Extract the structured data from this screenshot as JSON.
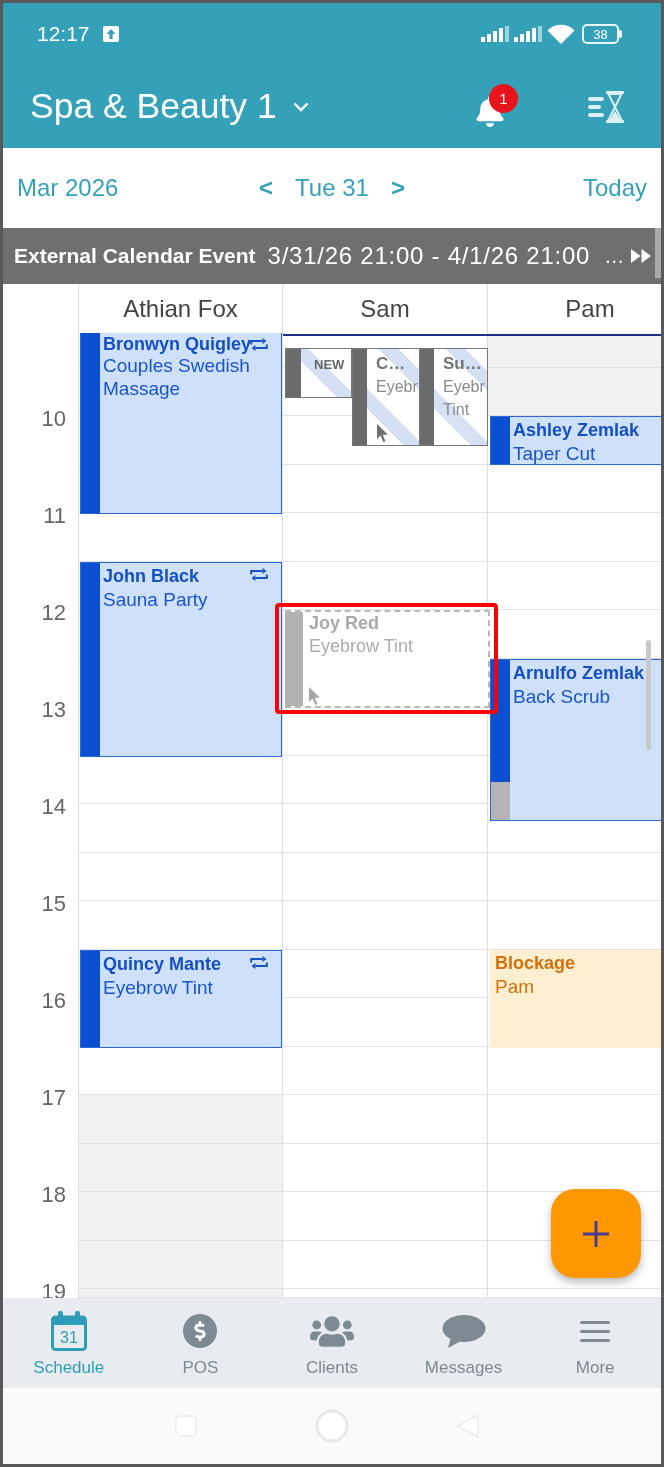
{
  "status_bar": {
    "time": "12:17",
    "battery": "38"
  },
  "app_bar": {
    "title": "Spa & Beauty 1",
    "notification_count": "1"
  },
  "date_nav": {
    "month": "Mar 2026",
    "prev": "<",
    "day": "Tue 31",
    "next": ">",
    "today": "Today"
  },
  "external_event": {
    "title": "External Calendar Event",
    "range": "3/31/26 21:00 - 4/1/26 21:00",
    "overflow": "…"
  },
  "hours": [
    "10",
    "11",
    "12",
    "13",
    "14",
    "15",
    "16",
    "17",
    "18",
    "19"
  ],
  "columns": [
    {
      "name": "Athian Fox",
      "events": [
        {
          "kind": "appointment",
          "client": "Bronwyn Quigley",
          "service": "Couples Swedish Massage",
          "recurring": true,
          "buffer_time": false
        },
        {
          "kind": "appointment",
          "client": "John Black",
          "service": "Sauna Party",
          "recurring": true,
          "buffer_time": false
        },
        {
          "kind": "appointment",
          "client": "Quincy Mante",
          "service": "Eyebrow Tint",
          "recurring": true,
          "buffer_time": false
        }
      ]
    },
    {
      "name": "Sam",
      "events": [
        {
          "kind": "new",
          "label": "NEW"
        },
        {
          "kind": "pending",
          "client": "C…",
          "service": "Eyebr",
          "pointer": true
        },
        {
          "kind": "pending",
          "client": "Su…",
          "service": "Eyebr Tint",
          "pointer": false
        },
        {
          "kind": "ghost",
          "client": "Joy Red",
          "service": "Eyebrow Tint",
          "pointer": true,
          "highlighted": true
        }
      ]
    },
    {
      "name": "Pam",
      "events": [
        {
          "kind": "appointment",
          "client": "Ashley Zemlak",
          "service": "Taper Cut",
          "recurring": false,
          "buffer_time": false
        },
        {
          "kind": "appointment",
          "client": "Arnulfo Zemlak",
          "service": "Back Scrub",
          "recurring": false,
          "buffer_time": true
        },
        {
          "kind": "blockage",
          "title": "Blockage",
          "staff": "Pam"
        }
      ]
    }
  ],
  "bottom_nav": [
    {
      "label": "Schedule",
      "icon_text": "31",
      "selected": true
    },
    {
      "label": "POS",
      "selected": false
    },
    {
      "label": "Clients",
      "selected": false
    },
    {
      "label": "Messages",
      "selected": false
    },
    {
      "label": "More",
      "selected": false
    }
  ]
}
